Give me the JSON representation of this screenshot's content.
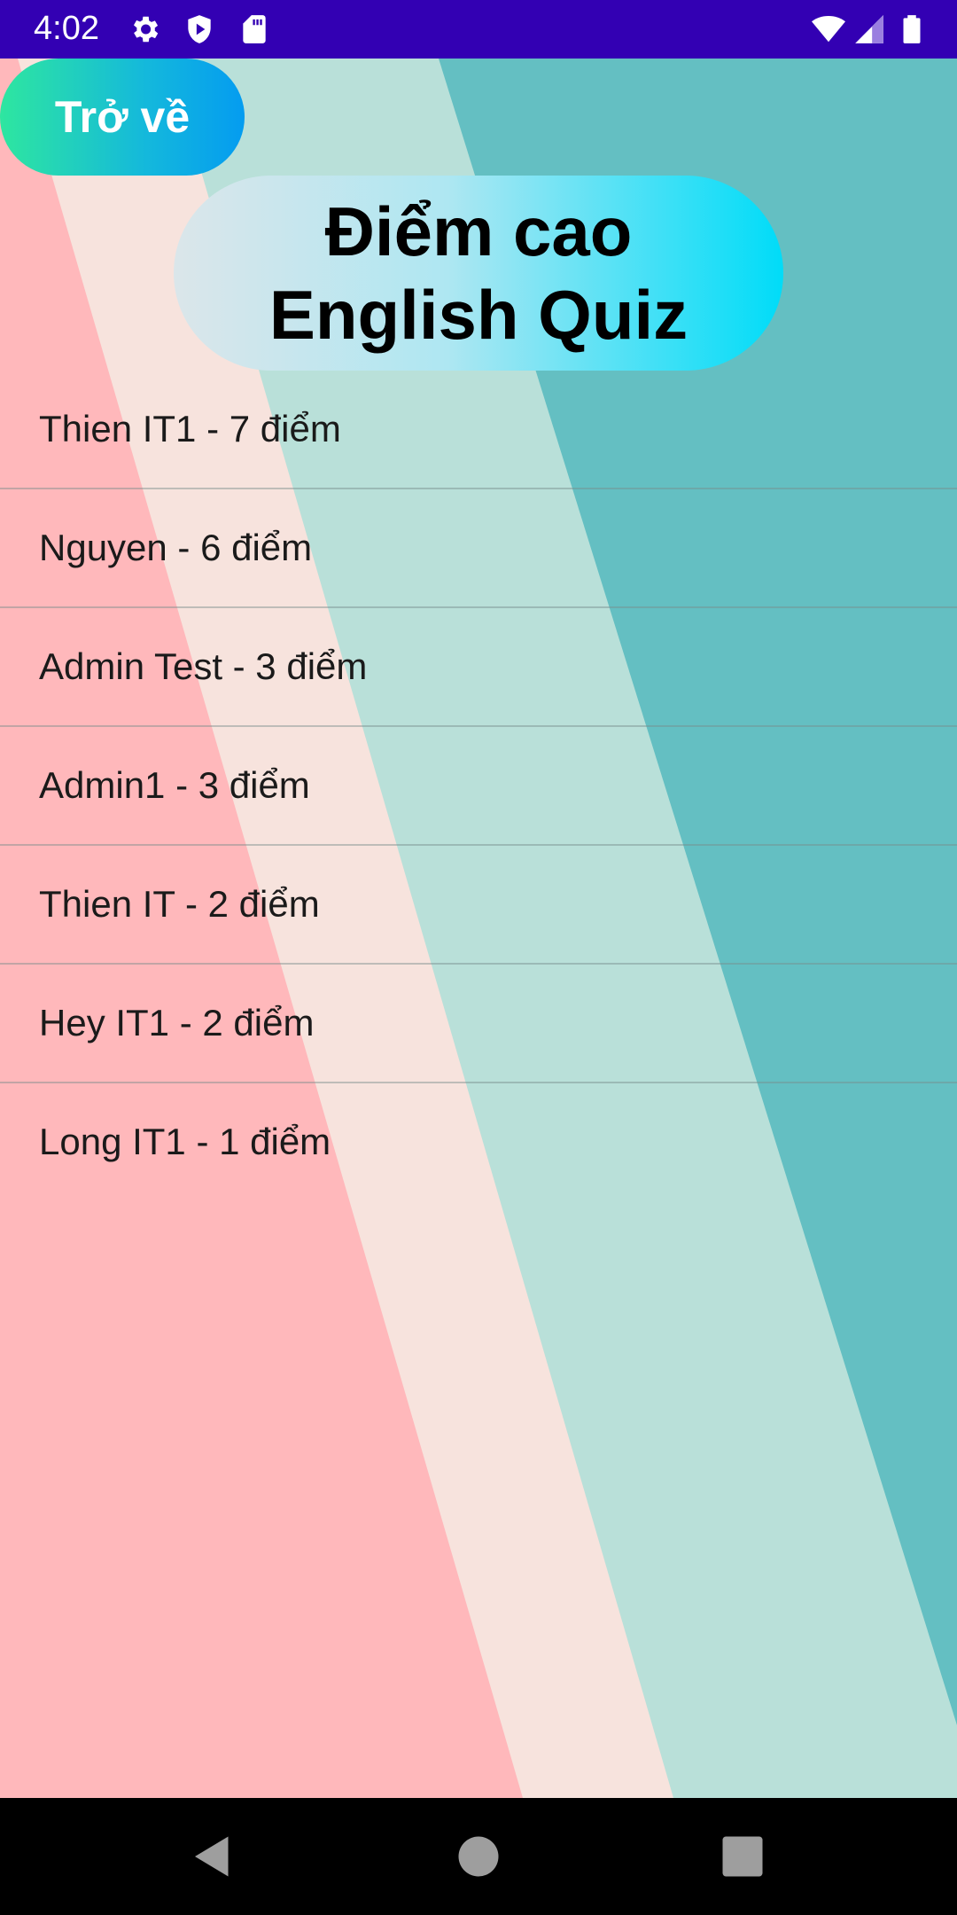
{
  "status_bar": {
    "time": "4:02",
    "icons_left": [
      "settings-icon",
      "shield-play-icon",
      "sd-card-icon"
    ],
    "icons_right": [
      "wifi-icon",
      "cell-signal-icon",
      "battery-icon"
    ]
  },
  "back_button": {
    "label": "Trở về"
  },
  "title": {
    "line1": "Điểm cao",
    "line2": "English Quiz"
  },
  "scores": [
    {
      "text": "Thien IT1 - 7 điểm"
    },
    {
      "text": "Nguyen - 6 điểm"
    },
    {
      "text": "Admin Test - 3 điểm"
    },
    {
      "text": "Admin1 - 3 điểm"
    },
    {
      "text": "Thien IT - 2 điểm"
    },
    {
      "text": "Hey IT1 - 2 điểm"
    },
    {
      "text": "Long IT1 - 1 điểm"
    }
  ],
  "nav_bar": {
    "buttons": [
      "back-icon",
      "home-icon",
      "recents-icon"
    ]
  },
  "colors": {
    "status_bar": "#3300b3",
    "stripe_pink": "#ffb8bb",
    "stripe_cream": "#f7e3dd",
    "stripe_mint": "#b9e0d9",
    "stripe_teal": "#64bfc2"
  }
}
